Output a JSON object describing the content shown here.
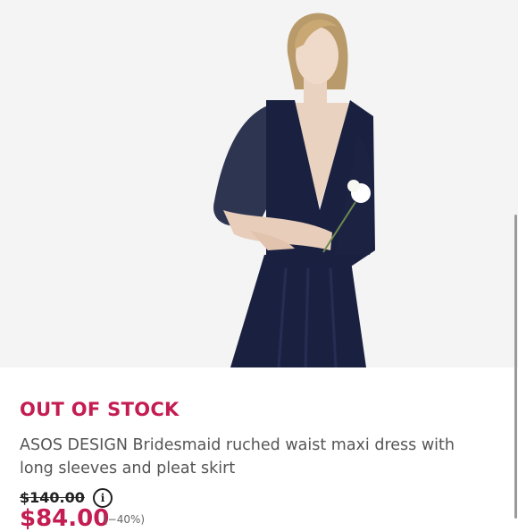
{
  "product": {
    "image_alt": "Model wearing navy long-sleeve maxi dress holding a white rose",
    "status": "OUT OF STOCK",
    "title": "ASOS DESIGN Bridesmaid ruched waist maxi dress with long sleeves and pleat skirt",
    "original_price": "$140.00",
    "sale_price": "$84.00",
    "sale_note": "(−40%)"
  },
  "colors": {
    "accent": "#c41d53",
    "dress": "#1a2140",
    "background": "#f3f4f3"
  },
  "icons": {
    "price_info": "info-circle-icon"
  }
}
